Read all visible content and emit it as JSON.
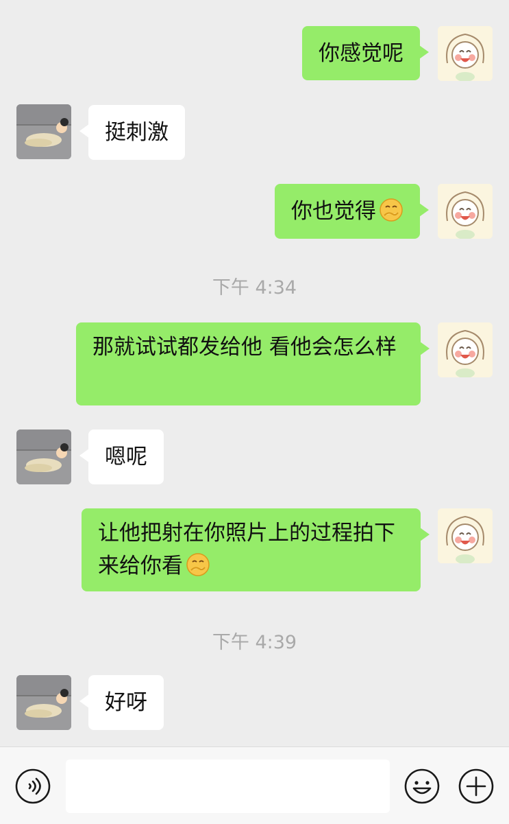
{
  "messages": [
    {
      "side": "me",
      "text": "你感觉呢"
    },
    {
      "side": "them",
      "text": "挺刺激"
    },
    {
      "side": "me",
      "text": "你也觉得",
      "emoji": "blushing-hand-face-emoji"
    },
    {
      "timestamp": "下午 4:34"
    },
    {
      "side": "me",
      "text": "那就试试都发给他 看他会怎么样"
    },
    {
      "side": "them",
      "text": "嗯呢"
    },
    {
      "side": "me",
      "text": "让他把射在你照片上的过程拍下来给你看",
      "emoji": "blushing-hand-face-emoji"
    },
    {
      "timestamp": "下午 4:39"
    },
    {
      "side": "them",
      "text": "好呀"
    }
  ],
  "input": {
    "value": "",
    "placeholder": ""
  },
  "toolbar": {
    "left_icon": "voice-icon",
    "emoji_icon": "emoji-face-icon",
    "more_icon": "plus-circle-icon"
  },
  "colors": {
    "background": "#ededed",
    "outgoing_bubble": "#95ec69",
    "incoming_bubble": "#ffffff",
    "timestamp_text": "#a9a9a9"
  }
}
